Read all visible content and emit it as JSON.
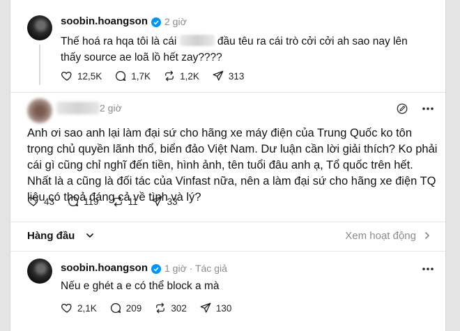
{
  "post1": {
    "handle": "soobin.hoangson",
    "time": "2 giờ",
    "text_before": "Thế hoá ra hqa tôi là cái ",
    "text_after": " đầu têu ra cái trò cởi cởi ah sao nay lên thấy source ae loã lồ hết zay????",
    "likes": "12,5K",
    "comments": "1,7K",
    "reposts": "1,2K",
    "shares": "313"
  },
  "comment": {
    "time": "2 giờ",
    "text": "Anh ơi sao anh lại làm đại sứ cho hãng xe máy điện của Trung Quốc ko tôn trọng chủ quyền lãnh thổ, biển đảo Việt Nam. Dư luận cần lời giải thích? Ko phải cái gì cũng chỉ nghĩ đến tiền, hình ảnh, tên tuổi đâu anh ạ, Tổ quốc trên hết. Nhất là a cũng là đối tác của Vinfast nữa, nên a làm đại sứ cho hãng xe điện TQ liệu có thoả đáng cả về tình và lý?",
    "likes": "43",
    "comments": "119",
    "reposts": "11",
    "shares": "33"
  },
  "sort_bar": {
    "sort_label": "Hàng đầu",
    "activity_label": "Xem hoạt động"
  },
  "reply": {
    "handle": "soobin.hoangson",
    "time": "1 giờ",
    "separator": "·",
    "author_tag": "Tác giả",
    "text": "Nếu e ghét a e có thể block a mà",
    "likes": "2,1K",
    "comments": "209",
    "reposts": "302",
    "shares": "130"
  },
  "colors": {
    "verified": "#0095f6",
    "muted": "#8a8a8a"
  }
}
